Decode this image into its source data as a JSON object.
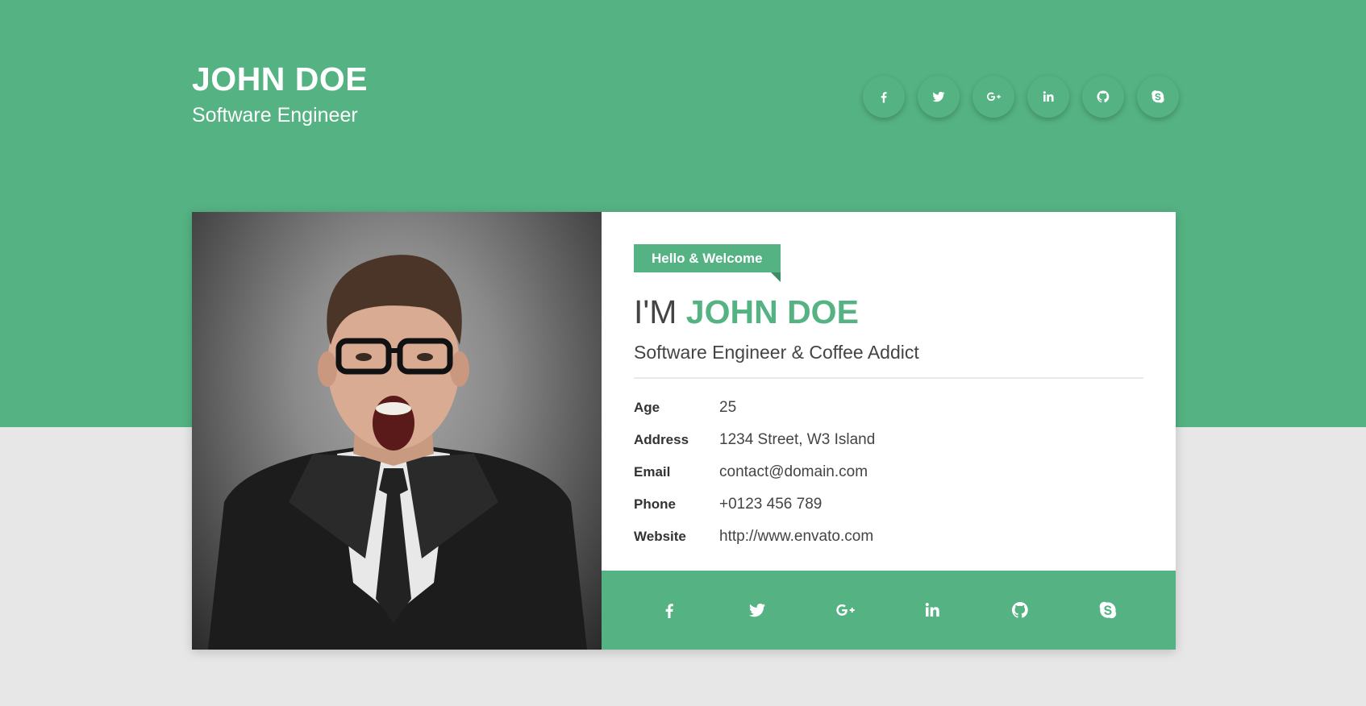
{
  "header": {
    "name": "JOHN DOE",
    "role": "Software Engineer",
    "social": [
      {
        "icon": "facebook-icon"
      },
      {
        "icon": "twitter-icon"
      },
      {
        "icon": "google-plus-icon"
      },
      {
        "icon": "linkedin-icon"
      },
      {
        "icon": "github-icon"
      },
      {
        "icon": "skype-icon"
      }
    ]
  },
  "card": {
    "ribbon": "Hello & Welcome",
    "headline_prefix": "I'M ",
    "headline_name": "JOHN DOE",
    "tagline": "Software Engineer & Coffee Addict",
    "details": [
      {
        "label": "Age",
        "value": "25"
      },
      {
        "label": "Address",
        "value": "1234 Street, W3 Island"
      },
      {
        "label": "Email",
        "value": "contact@domain.com"
      },
      {
        "label": "Phone",
        "value": "+0123 456 789"
      },
      {
        "label": "Website",
        "value": "http://www.envato.com"
      }
    ]
  },
  "colors": {
    "accent": "#54b283",
    "background": "#e7e7e7",
    "card": "#ffffff",
    "text": "#444444"
  }
}
